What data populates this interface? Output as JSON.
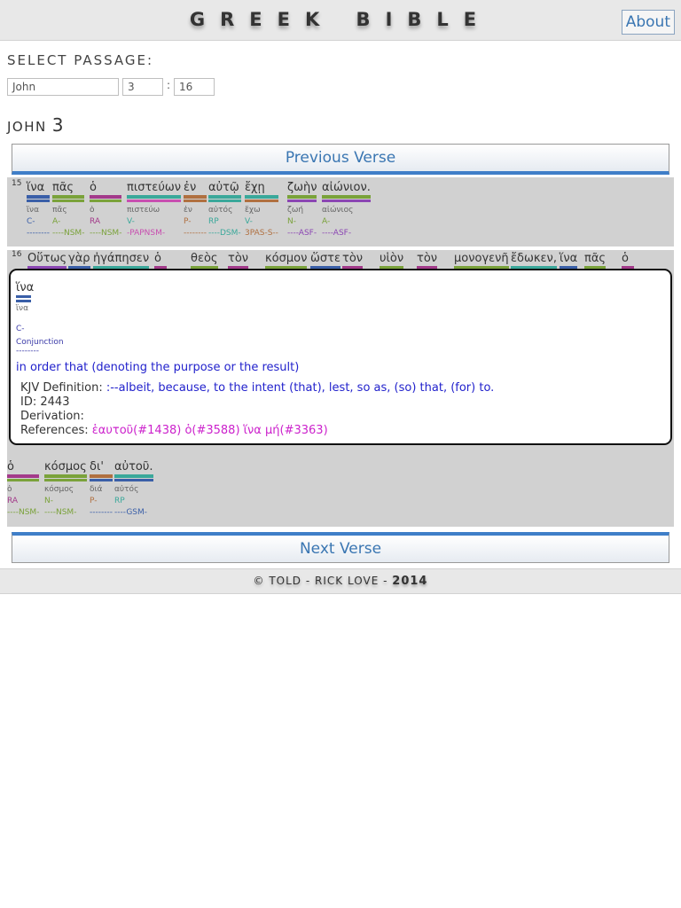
{
  "header": {
    "title": "GREEK BIBLE",
    "about_label": "About"
  },
  "passage": {
    "label": "SELECT PASSAGE:",
    "book": "John",
    "chapter": "3",
    "verse": "16",
    "separator": ":"
  },
  "chapter_heading": {
    "book": "JOHN",
    "number": "3"
  },
  "nav": {
    "previous": "Previous Verse",
    "next": "Next Verse"
  },
  "colors": {
    "conjunction": "#3a5fa8",
    "adjective": "#7aa23a",
    "article": "#a33a8a",
    "verb": "#c84eb0",
    "participle": "#c84eb0",
    "preposition": "#b07040",
    "pronoun": "#3aa89a",
    "noun": "#8b46b3",
    "panel": "#d1d1d1",
    "accent": "#3f7ec8"
  },
  "verse15": {
    "number": "15",
    "words": [
      {
        "g": "ἵνα",
        "l": "ἵνα",
        "p": "C-",
        "pr": "--------",
        "c1": "#3a5fa8",
        "c2": "#3a5fa8"
      },
      {
        "g": "πᾶς",
        "l": "πᾶς",
        "p": "A-",
        "pr": "----NSM-",
        "c1": "#7aa23a",
        "c2": "#7aa23a"
      },
      {
        "g": "ὁ",
        "l": "ὁ",
        "p": "RA",
        "pr": "----NSM-",
        "c1": "#a33a8a",
        "c2": "#7aa23a"
      },
      {
        "g": "πιστεύων",
        "l": "πιστεύω",
        "p": "V-",
        "pr": "-PAPNSM-",
        "c1": "#3aa89a",
        "c2": "#c84eb0"
      },
      {
        "g": "ἐν",
        "l": "ἐν",
        "p": "P-",
        "pr": "--------",
        "c1": "#b07040",
        "c2": "#b07040"
      },
      {
        "g": "αὐτῷ",
        "l": "αὐτός",
        "p": "RP",
        "pr": "----DSM-",
        "c1": "#3aa89a",
        "c2": "#3aa89a"
      },
      {
        "g": "ἔχῃ",
        "l": "ἔχω",
        "p": "V-",
        "pr": "3PAS-S--",
        "c1": "#3aa89a",
        "c2": "#b07040"
      },
      {
        "g": "ζωὴν",
        "l": "ζωή",
        "p": "N-",
        "pr": "----ASF-",
        "c1": "#7aa23a",
        "c2": "#8b46b3"
      },
      {
        "g": "αἰώνιον.",
        "l": "αἰώνιος",
        "p": "A-",
        "pr": "----ASF-",
        "c1": "#7aa23a",
        "c2": "#8b46b3"
      }
    ]
  },
  "verse16": {
    "number": "16",
    "words": [
      "Οὕτως",
      "γὰρ",
      "ἠγάπησεν",
      "ὁ",
      "θεὸς",
      "τὸν",
      "κόσμον",
      "ὥστε",
      "τὸν",
      "υἱὸν",
      "τὸν",
      "μονογενῆ",
      "ἔδωκεν,",
      "ἵνα",
      "πᾶς",
      "ὁ"
    ],
    "bar_colors": [
      "#8b46b3",
      "#3a5fa8",
      "#3aa89a",
      "#a33a8a",
      "#7aa23a",
      "#a33a8a",
      "#7aa23a",
      "#3a5fa8",
      "#a33a8a",
      "#7aa23a",
      "#a33a8a",
      "#7aa23a",
      "#3aa89a",
      "#3a5fa8",
      "#7aa23a",
      "#a33a8a"
    ],
    "tail": [
      {
        "g": "ὁ",
        "l": "ὁ",
        "p": "RA",
        "pr": "----NSM-",
        "c1": "#a33a8a",
        "c2": "#7aa23a"
      },
      {
        "g": "κόσμος",
        "l": "κόσμος",
        "p": "N-",
        "pr": "----NSM-",
        "c1": "#7aa23a",
        "c2": "#7aa23a"
      },
      {
        "g": "δι'",
        "l": "διά",
        "p": "P-",
        "pr": "--------",
        "c1": "#b07040",
        "c2": "#3a5fa8"
      },
      {
        "g": "αὐτοῦ.",
        "l": "αὐτός",
        "p": "RP",
        "pr": "----GSM-",
        "c1": "#3aa89a",
        "c2": "#3a5fa8"
      }
    ]
  },
  "popup": {
    "word": "ἵνα",
    "lemma": "ἵνα",
    "pos_code": "C-",
    "pos_name": "Conjunction",
    "parse": "--------",
    "definition": "in order that (denoting the purpose or the result)",
    "kjv_label": "KJV Definition:",
    "kjv_value": ":--albeit, because, to the intent (that), lest, so as, (so) that, (for) to.",
    "id_label": "ID:",
    "id_value": "2443",
    "derivation_label": "Derivation:",
    "derivation_value": "",
    "references_label": "References:",
    "references_value": "ἑαυτοῦ(#1438) ὁ(#3588) ἵνα μή(#3363)"
  },
  "footer": {
    "copy": "© TOLD",
    "dash": "-",
    "author": "RICK LOVE",
    "year": "2014"
  }
}
